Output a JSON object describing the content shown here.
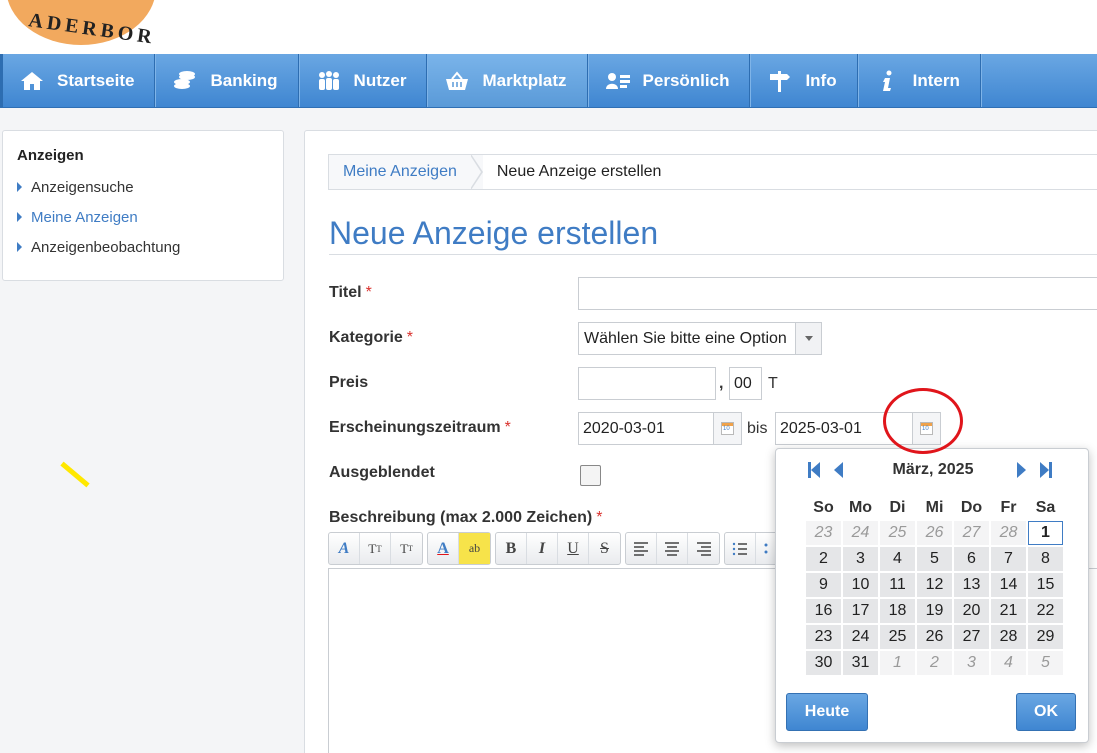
{
  "logo": {
    "text": "ADERBOR"
  },
  "nav": {
    "items": [
      {
        "label": "Startseite",
        "icon": "home-icon"
      },
      {
        "label": "Banking",
        "icon": "coins-icon"
      },
      {
        "label": "Nutzer",
        "icon": "users-icon"
      },
      {
        "label": "Marktplatz",
        "icon": "basket-icon"
      },
      {
        "label": "Persönlich",
        "icon": "id-card-icon"
      },
      {
        "label": "Info",
        "icon": "signpost-icon"
      },
      {
        "label": "Intern",
        "icon": "info-icon"
      }
    ],
    "active": "Marktplatz"
  },
  "sidebar": {
    "title": "Anzeigen",
    "items": [
      {
        "label": "Anzeigensuche"
      },
      {
        "label": "Meine Anzeigen"
      },
      {
        "label": "Anzeigenbeobachtung"
      }
    ]
  },
  "breadcrumb": {
    "parent": "Meine Anzeigen",
    "current": "Neue Anzeige erstellen"
  },
  "page": {
    "title": "Neue Anzeige erstellen"
  },
  "form": {
    "titel_label": "Titel",
    "titel_value": "",
    "kategorie_label": "Kategorie",
    "kategorie_value": "Wählen Sie bitte eine Option",
    "preis_label": "Preis",
    "preis_value": "",
    "preis_comma": ",",
    "preis_cents": "00",
    "preis_unit": "T",
    "zeitraum_label": "Erscheinungszeitraum",
    "zeitraum_from": "2020-03-01",
    "zeitraum_bis": "bis",
    "zeitraum_to": "2025-03-01",
    "ausgeblendet_label": "Ausgeblendet",
    "beschreibung_label": "Beschreibung (max 2.000 Zeichen)",
    "required_mark": "*"
  },
  "toolbar": {
    "buttons": [
      "font-style-icon",
      "font-size-up-icon",
      "font-size-down-icon",
      "font-color-icon",
      "highlight-icon",
      "bold-icon",
      "italic-icon",
      "underline-icon",
      "strikethrough-icon",
      "align-left-icon",
      "align-center-icon",
      "align-right-icon",
      "ordered-list-icon"
    ]
  },
  "datepicker": {
    "month_label": "März, 2025",
    "weekdays": [
      "So",
      "Mo",
      "Di",
      "Mi",
      "Do",
      "Fr",
      "Sa"
    ],
    "weeks": [
      [
        "23",
        "24",
        "25",
        "26",
        "27",
        "28",
        "1"
      ],
      [
        "2",
        "3",
        "4",
        "5",
        "6",
        "7",
        "8"
      ],
      [
        "9",
        "10",
        "11",
        "12",
        "13",
        "14",
        "15"
      ],
      [
        "16",
        "17",
        "18",
        "19",
        "20",
        "21",
        "22"
      ],
      [
        "23",
        "24",
        "25",
        "26",
        "27",
        "28",
        "29"
      ],
      [
        "30",
        "31",
        "1",
        "2",
        "3",
        "4",
        "5"
      ]
    ],
    "selected": "1",
    "today_button": "Heute",
    "ok_button": "OK"
  },
  "colors": {
    "accent": "#3f7cc4",
    "nav": "#4a8fd6",
    "required": "#d9302c",
    "annotation": "#e0151b"
  }
}
